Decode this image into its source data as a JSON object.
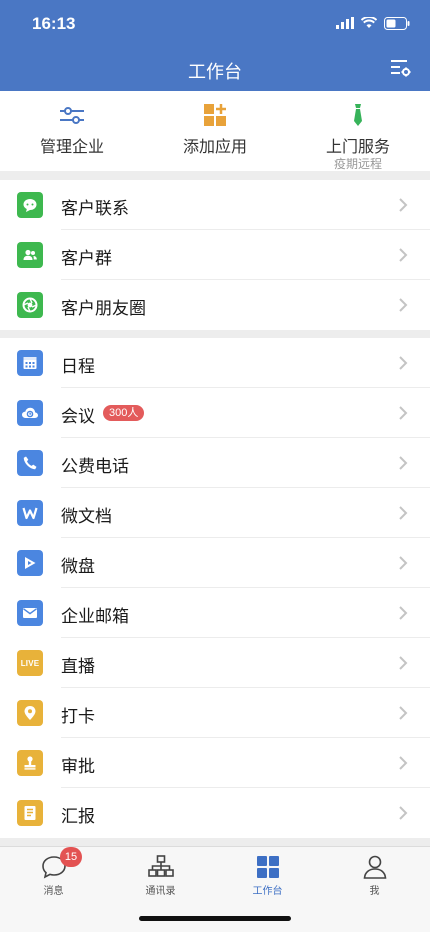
{
  "status": {
    "time": "16:13"
  },
  "header": {
    "title": "工作台"
  },
  "quick_actions": [
    {
      "label": "管理企业",
      "sublabel": "",
      "icon": "sliders-icon"
    },
    {
      "label": "添加应用",
      "sublabel": "",
      "icon": "add-app-icon"
    },
    {
      "label": "上门服务",
      "sublabel": "疫期远程",
      "icon": "tie-icon"
    }
  ],
  "group1": [
    {
      "label": "客户联系",
      "icon": "chat-bubble-icon",
      "color": "#3eb84f"
    },
    {
      "label": "客户群",
      "icon": "group-users-icon",
      "color": "#3eb84f"
    },
    {
      "label": "客户朋友圈",
      "icon": "shutter-icon",
      "color": "#3eb84f"
    }
  ],
  "group2": [
    {
      "label": "日程",
      "icon": "calendar-icon",
      "color": "#4b86e0",
      "badge": ""
    },
    {
      "label": "会议",
      "icon": "cloud-meeting-icon",
      "color": "#4b86e0",
      "badge": "300人"
    },
    {
      "label": "公费电话",
      "icon": "phone-icon",
      "color": "#4b86e0",
      "badge": ""
    },
    {
      "label": "微文档",
      "icon": "w-doc-icon",
      "color": "#4b86e0",
      "badge": ""
    },
    {
      "label": "微盘",
      "icon": "drive-icon",
      "color": "#4b86e0",
      "badge": ""
    },
    {
      "label": "企业邮箱",
      "icon": "mail-icon",
      "color": "#4b86e0",
      "badge": ""
    },
    {
      "label": "直播",
      "icon": "live-icon",
      "color": "#e8b23a",
      "badge": "",
      "icon_text": "LIVE"
    },
    {
      "label": "打卡",
      "icon": "location-pin-icon",
      "color": "#e8b23a",
      "badge": ""
    },
    {
      "label": "审批",
      "icon": "stamp-icon",
      "color": "#e8b23a",
      "badge": ""
    },
    {
      "label": "汇报",
      "icon": "report-icon",
      "color": "#e8b23a",
      "badge": ""
    }
  ],
  "tabbar": [
    {
      "label": "消息",
      "icon": "message-bubble-icon",
      "badge": "15",
      "active": false
    },
    {
      "label": "通讯录",
      "icon": "org-chart-icon",
      "badge": "",
      "active": false
    },
    {
      "label": "工作台",
      "icon": "grid-apps-icon",
      "badge": "",
      "active": true
    },
    {
      "label": "我",
      "icon": "person-icon",
      "badge": "",
      "active": false
    }
  ],
  "colors": {
    "header": "#4a77c4",
    "accent": "#3d6fc4",
    "badge": "#e35b5b"
  }
}
